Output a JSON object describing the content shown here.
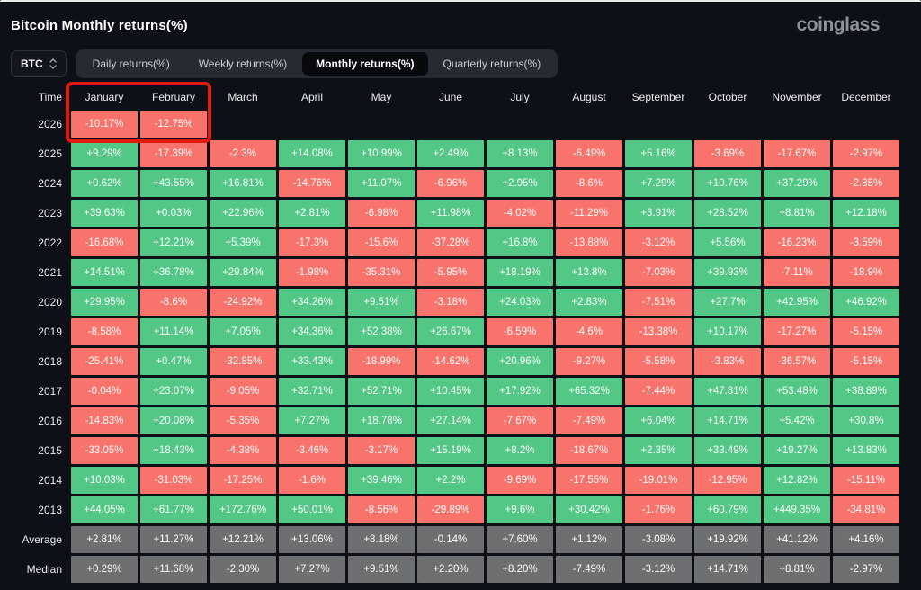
{
  "header": {
    "title": "Bitcoin Monthly returns(%)",
    "logo": "coinglass"
  },
  "controls": {
    "coin_selector": {
      "value": "BTC"
    },
    "tabs": [
      {
        "label": "Daily returns(%)",
        "active": false
      },
      {
        "label": "Weekly returns(%)",
        "active": false
      },
      {
        "label": "Monthly returns(%)",
        "active": true
      },
      {
        "label": "Quarterly returns(%)",
        "active": false
      }
    ]
  },
  "colors": {
    "positive": "#53c786",
    "negative": "#f7736c",
    "summary": "#6e6f71",
    "highlight_border": "#e11a0e",
    "background": "#0d1017"
  },
  "chart_data": {
    "type": "heatmap",
    "title": "Bitcoin Monthly returns(%)",
    "time_column_header": "Time",
    "categories": [
      "January",
      "February",
      "March",
      "April",
      "May",
      "June",
      "July",
      "August",
      "September",
      "October",
      "November",
      "December"
    ],
    "rows": [
      {
        "label": "2026",
        "summary": false,
        "values": [
          "-10.17%",
          "-12.75%",
          null,
          null,
          null,
          null,
          null,
          null,
          null,
          null,
          null,
          null
        ]
      },
      {
        "label": "2025",
        "summary": false,
        "values": [
          "+9.29%",
          "-17.39%",
          "-2.3%",
          "+14.08%",
          "+10.99%",
          "+2.49%",
          "+8.13%",
          "-6.49%",
          "+5.16%",
          "-3.69%",
          "-17.67%",
          "-2.97%"
        ]
      },
      {
        "label": "2024",
        "summary": false,
        "values": [
          "+0.62%",
          "+43.55%",
          "+16.81%",
          "-14.76%",
          "+11.07%",
          "-6.96%",
          "+2.95%",
          "-8.6%",
          "+7.29%",
          "+10.76%",
          "+37.29%",
          "-2.85%"
        ]
      },
      {
        "label": "2023",
        "summary": false,
        "values": [
          "+39.63%",
          "+0.03%",
          "+22.96%",
          "+2.81%",
          "-6.98%",
          "+11.98%",
          "-4.02%",
          "-11.29%",
          "+3.91%",
          "+28.52%",
          "+8.81%",
          "+12.18%"
        ]
      },
      {
        "label": "2022",
        "summary": false,
        "values": [
          "-16.68%",
          "+12.21%",
          "+5.39%",
          "-17.3%",
          "-15.6%",
          "-37.28%",
          "+16.8%",
          "-13.88%",
          "-3.12%",
          "+5.56%",
          "-16.23%",
          "-3.59%"
        ]
      },
      {
        "label": "2021",
        "summary": false,
        "values": [
          "+14.51%",
          "+36.78%",
          "+29.84%",
          "-1.98%",
          "-35.31%",
          "-5.95%",
          "+18.19%",
          "+13.8%",
          "-7.03%",
          "+39.93%",
          "-7.11%",
          "-18.9%"
        ]
      },
      {
        "label": "2020",
        "summary": false,
        "values": [
          "+29.95%",
          "-8.6%",
          "-24.92%",
          "+34.26%",
          "+9.51%",
          "-3.18%",
          "+24.03%",
          "+2.83%",
          "-7.51%",
          "+27.7%",
          "+42.95%",
          "+46.92%"
        ]
      },
      {
        "label": "2019",
        "summary": false,
        "values": [
          "-8.58%",
          "+11.14%",
          "+7.05%",
          "+34.36%",
          "+52.38%",
          "+26.67%",
          "-6.59%",
          "-4.6%",
          "-13.38%",
          "+10.17%",
          "-17.27%",
          "-5.15%"
        ]
      },
      {
        "label": "2018",
        "summary": false,
        "values": [
          "-25.41%",
          "+0.47%",
          "-32.85%",
          "+33.43%",
          "-18.99%",
          "-14.62%",
          "+20.96%",
          "-9.27%",
          "-5.58%",
          "-3.83%",
          "-36.57%",
          "-5.15%"
        ]
      },
      {
        "label": "2017",
        "summary": false,
        "values": [
          "-0.04%",
          "+23.07%",
          "-9.05%",
          "+32.71%",
          "+52.71%",
          "+10.45%",
          "+17.92%",
          "+65.32%",
          "-7.44%",
          "+47.81%",
          "+53.48%",
          "+38.89%"
        ]
      },
      {
        "label": "2016",
        "summary": false,
        "values": [
          "-14.83%",
          "+20.08%",
          "-5.35%",
          "+7.27%",
          "+18.78%",
          "+27.14%",
          "-7.67%",
          "-7.49%",
          "+6.04%",
          "+14.71%",
          "+5.42%",
          "+30.8%"
        ]
      },
      {
        "label": "2015",
        "summary": false,
        "values": [
          "-33.05%",
          "+18.43%",
          "-4.38%",
          "-3.46%",
          "-3.17%",
          "+15.19%",
          "+8.2%",
          "-18.67%",
          "+2.35%",
          "+33.49%",
          "+19.27%",
          "+13.83%"
        ]
      },
      {
        "label": "2014",
        "summary": false,
        "values": [
          "+10.03%",
          "-31.03%",
          "-17.25%",
          "-1.6%",
          "+39.46%",
          "+2.2%",
          "-9.69%",
          "-17.55%",
          "-19.01%",
          "-12.95%",
          "+12.82%",
          "-15.11%"
        ]
      },
      {
        "label": "2013",
        "summary": false,
        "values": [
          "+44.05%",
          "+61.77%",
          "+172.76%",
          "+50.01%",
          "-8.56%",
          "-29.89%",
          "+9.6%",
          "+30.42%",
          "-1.76%",
          "+60.79%",
          "+449.35%",
          "-34.81%"
        ]
      },
      {
        "label": "Average",
        "summary": true,
        "values": [
          "+2.81%",
          "+11.27%",
          "+12.21%",
          "+13.06%",
          "+8.18%",
          "-0.14%",
          "+7.60%",
          "+1.12%",
          "-3.08%",
          "+19.92%",
          "+41.12%",
          "+4.16%"
        ]
      },
      {
        "label": "Median",
        "summary": true,
        "values": [
          "+0.29%",
          "+11.68%",
          "-2.30%",
          "+7.27%",
          "+9.51%",
          "+2.20%",
          "+8.20%",
          "-7.49%",
          "-3.12%",
          "+14.71%",
          "+8.81%",
          "-2.97%"
        ]
      }
    ],
    "highlight": {
      "row": "2026",
      "columns": [
        "January",
        "February"
      ]
    }
  }
}
